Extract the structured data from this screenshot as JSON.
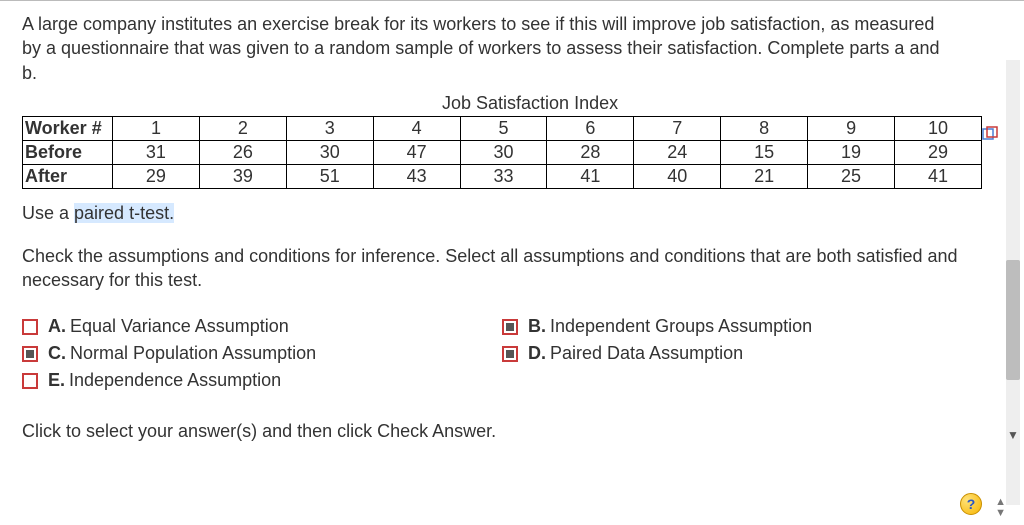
{
  "question": "A large company institutes an exercise break for its workers to see if this will improve job satisfaction, as measured by a questionnaire that was given to a random sample of workers to assess their satisfaction. Complete parts a and b.",
  "table": {
    "title": "Job Satisfaction Index",
    "row_headers": [
      "Worker #",
      "Before",
      "After"
    ],
    "worker": [
      "1",
      "2",
      "3",
      "4",
      "5",
      "6",
      "7",
      "8",
      "9",
      "10"
    ],
    "before": [
      "31",
      "26",
      "30",
      "47",
      "30",
      "28",
      "24",
      "15",
      "19",
      "29"
    ],
    "after": [
      "29",
      "39",
      "51",
      "43",
      "33",
      "41",
      "40",
      "21",
      "25",
      "41"
    ]
  },
  "instruction_prefix": "Use a ",
  "instruction_highlight": "paired t-test.",
  "check_text": "Check the assumptions and conditions for inference. Select all assumptions and conditions that are both satisfied and necessary for this test.",
  "options": {
    "A": {
      "label": "Equal Variance Assumption",
      "checked": false
    },
    "B": {
      "label": "Independent Groups Assumption",
      "checked": true
    },
    "C": {
      "label": "Normal Population Assumption",
      "checked": true
    },
    "D": {
      "label": "Paired Data Assumption",
      "checked": true
    },
    "E": {
      "label": "Independence Assumption",
      "checked": false
    }
  },
  "footer": "Click to select your answer(s) and then click Check Answer.",
  "help_label": "?"
}
